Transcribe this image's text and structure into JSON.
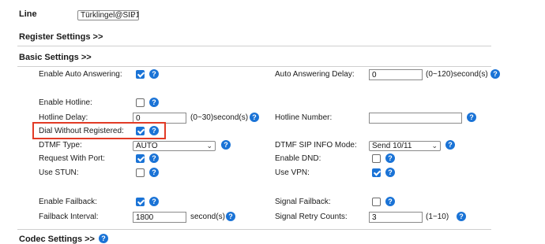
{
  "line": {
    "label": "Line",
    "selected": "Türklingel@SIP1"
  },
  "sections": {
    "register": "Register Settings >>",
    "basic": "Basic Settings >>",
    "bottom_partial": "Codec Settings >>"
  },
  "help_glyph": "?",
  "chevron_glyph": "⌄",
  "left": {
    "auto_answering": {
      "label": "Enable Auto Answering:",
      "checked": true
    },
    "hotline": {
      "label": "Enable Hotline:",
      "checked": false
    },
    "hotline_delay": {
      "label": "Hotline Delay:",
      "value": "0",
      "suffix": "(0~30)second(s)"
    },
    "dial_without_registered": {
      "label": "Dial Without Registered:",
      "checked": true
    },
    "dtmf_type": {
      "label": "DTMF Type:",
      "selected": "AUTO"
    },
    "request_with_port": {
      "label": "Request With Port:",
      "checked": true
    },
    "use_stun": {
      "label": "Use STUN:",
      "checked": false
    },
    "enable_failback": {
      "label": "Enable Failback:",
      "checked": true
    },
    "failback_interval": {
      "label": "Failback Interval:",
      "value": "1800",
      "suffix": "second(s)"
    }
  },
  "right": {
    "auto_answering_delay": {
      "label": "Auto Answering Delay:",
      "value": "0",
      "suffix": "(0~120)second(s)"
    },
    "hotline_number": {
      "label": "Hotline Number:",
      "value": ""
    },
    "dtmf_sip_info_mode": {
      "label": "DTMF SIP INFO Mode:",
      "selected": "Send 10/11"
    },
    "enable_dnd": {
      "label": "Enable DND:",
      "checked": false
    },
    "use_vpn": {
      "label": "Use VPN:",
      "checked": true
    },
    "signal_failback": {
      "label": "Signal Failback:",
      "checked": false
    },
    "signal_retry_counts": {
      "label": "Signal Retry Counts:",
      "value": "3",
      "suffix": "(1~10)"
    }
  },
  "colors": {
    "accent": "#1a73d6",
    "highlight_box": "#e23b26"
  }
}
